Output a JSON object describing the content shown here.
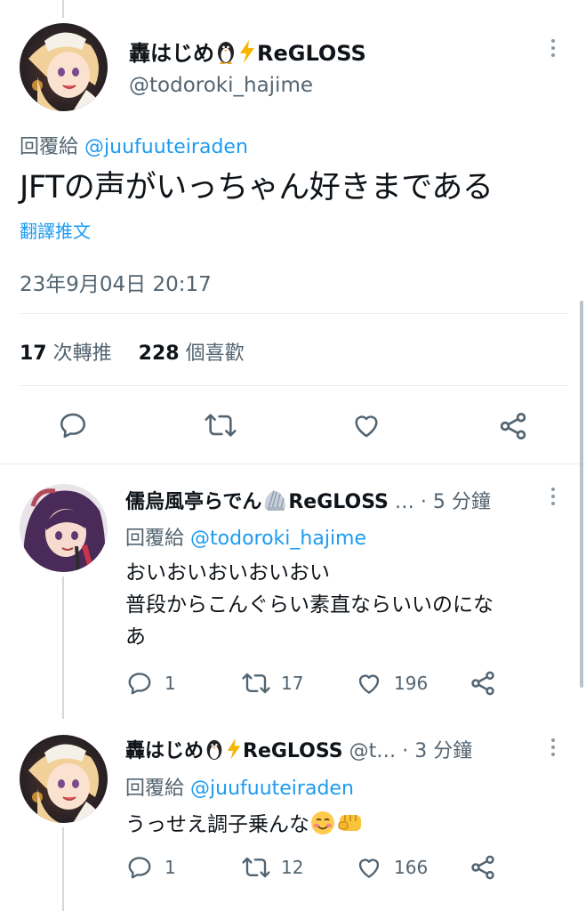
{
  "main_tweet": {
    "display_name": "轟はじめ",
    "name_suffix": "ReGLOSS",
    "handle": "@todoroki_hajime",
    "reply_prefix": "回覆給",
    "reply_to": "@juufuuteiraden",
    "text": "JFTの声がいっちゃん好きまである",
    "translate_label": "翻譯推文",
    "timestamp": "23年9月04日 20:17",
    "retweet_count": "17",
    "retweet_label": "次轉推",
    "like_count": "228",
    "like_label": "個喜歡"
  },
  "replies": [
    {
      "display_name": "儒烏風亭らでん",
      "name_suffix": "ReGLOSS",
      "handle_trunc": "…",
      "time": "· 5 分鐘",
      "reply_prefix": "回覆給",
      "reply_to": "@todoroki_hajime",
      "text_line1": "おいおいおいおいおい",
      "text_line2": "普段からこんぐらい素直ならいいのにな",
      "text_line3": "あ",
      "reply_count": "1",
      "retweet_count": "17",
      "like_count": "196"
    },
    {
      "display_name": "轟はじめ",
      "name_suffix": "ReGLOSS",
      "handle_trunc": "@t…",
      "time": "· 3 分鐘",
      "reply_prefix": "回覆給",
      "reply_to": "@juufuuteiraden",
      "text": "うっせえ調子乗んな",
      "reply_count": "1",
      "retweet_count": "12",
      "like_count": "166"
    }
  ],
  "colors": {
    "accent": "#1d9bf0",
    "muted": "#536471",
    "text": "#0f1419",
    "divider": "#e6ecf0"
  }
}
